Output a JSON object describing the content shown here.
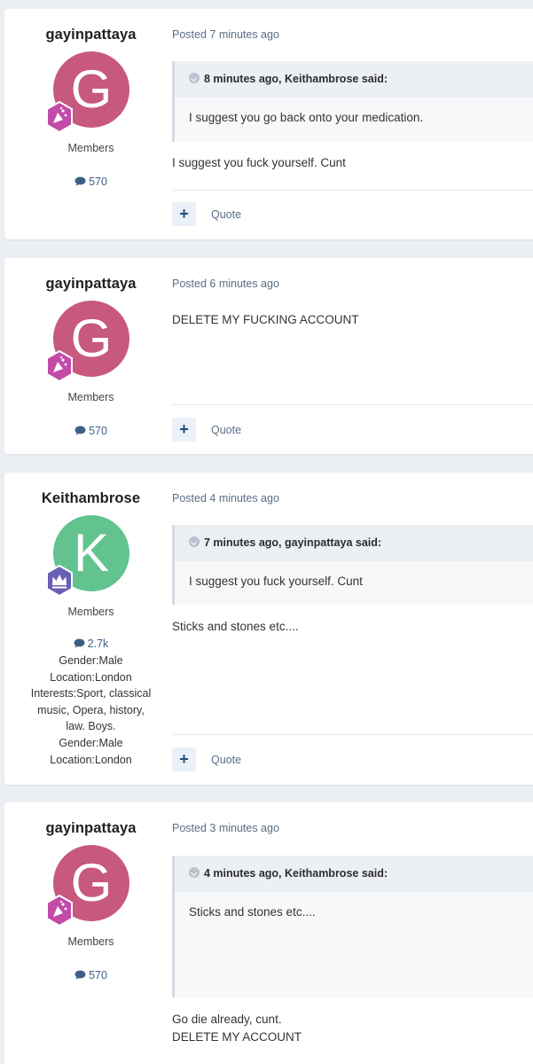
{
  "posts": [
    {
      "author": "gayinpattaya",
      "avatar_letter": "G",
      "avatar_color": "#c7587e",
      "group": "Members",
      "post_count": "570",
      "posted": "Posted 7 minutes ago",
      "quote": {
        "header": "8 minutes ago, Keithambrose said:",
        "text": "I suggest you go back onto your medication."
      },
      "content": [
        "I suggest you fuck yourself. Cunt"
      ],
      "actions": {
        "quote_label": "Quote",
        "plus_label": "+"
      }
    },
    {
      "author": "gayinpattaya",
      "avatar_letter": "G",
      "avatar_color": "#c7587e",
      "group": "Members",
      "post_count": "570",
      "posted": "Posted 6 minutes ago",
      "content": [
        "DELETE MY FUCKING ACCOUNT"
      ],
      "actions": {
        "quote_label": "Quote",
        "plus_label": "+"
      }
    },
    {
      "author": "Keithambrose",
      "avatar_letter": "K",
      "avatar_color": "#62c38e",
      "group": "Members",
      "post_count": "2.7k",
      "profile_fields": [
        "Gender:Male",
        "Location:London",
        "Interests:Sport, classical",
        "music, Opera, history,",
        "law. Boys.",
        "Gender:Male",
        "Location:London"
      ],
      "posted": "Posted 4 minutes ago",
      "quote": {
        "header": "7 minutes ago, gayinpattaya said:",
        "text": "I suggest you fuck yourself. Cunt"
      },
      "content": [
        "Sticks and stones etc...."
      ],
      "actions": {
        "quote_label": "Quote",
        "plus_label": "+"
      }
    },
    {
      "author": "gayinpattaya",
      "avatar_letter": "G",
      "avatar_color": "#c7587e",
      "group": "Members",
      "post_count": "570",
      "posted": "Posted 3 minutes ago",
      "quote": {
        "header": "4 minutes ago, Keithambrose said:",
        "text": "Sticks and stones etc...."
      },
      "content": [
        "Go die already, cunt.",
        "DELETE MY ACCOUNT"
      ]
    }
  ],
  "icons": {
    "comment": "comment-bubble-icon",
    "quote": "quote-collapse-icon",
    "rank_pink": "rank-badge-party-icon",
    "rank_purple": "rank-badge-crown-icon"
  },
  "colors": {
    "page_bg": "#ebeef2",
    "accent": "#1d4e7e",
    "meta": "#5a6d85"
  }
}
